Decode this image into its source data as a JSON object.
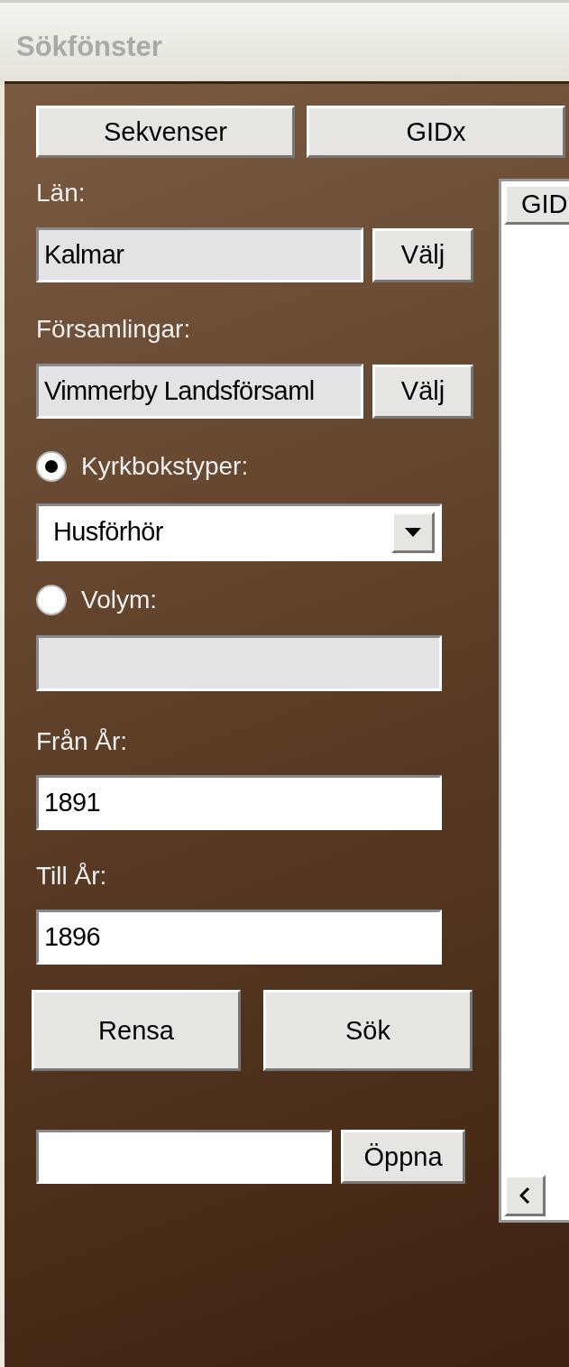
{
  "window": {
    "title": "Sökfönster"
  },
  "top_buttons": [
    "Sekvenser",
    "GIDx"
  ],
  "county": {
    "label": "Län:",
    "value": "Kalmar",
    "button": "Välj"
  },
  "parishes": {
    "label": "Församlingar:",
    "value": "Vimmerby Landsförsaml",
    "button": "Välj"
  },
  "search_mode": [
    {
      "label": "Kyrkbokstyper:",
      "selected": true
    },
    {
      "label": "Volym:",
      "selected": false
    }
  ],
  "book_type": {
    "value": "Husförhör"
  },
  "volume": {
    "disabled": true
  },
  "from_year": {
    "label": "Från År:",
    "value": "1891"
  },
  "to_year": {
    "label": "Till År:",
    "value": "1896"
  },
  "action_buttons": [
    "Rensa",
    "Sök"
  ],
  "open": {
    "button": "Öppna"
  },
  "results": {
    "columns": [
      "GID"
    ]
  }
}
